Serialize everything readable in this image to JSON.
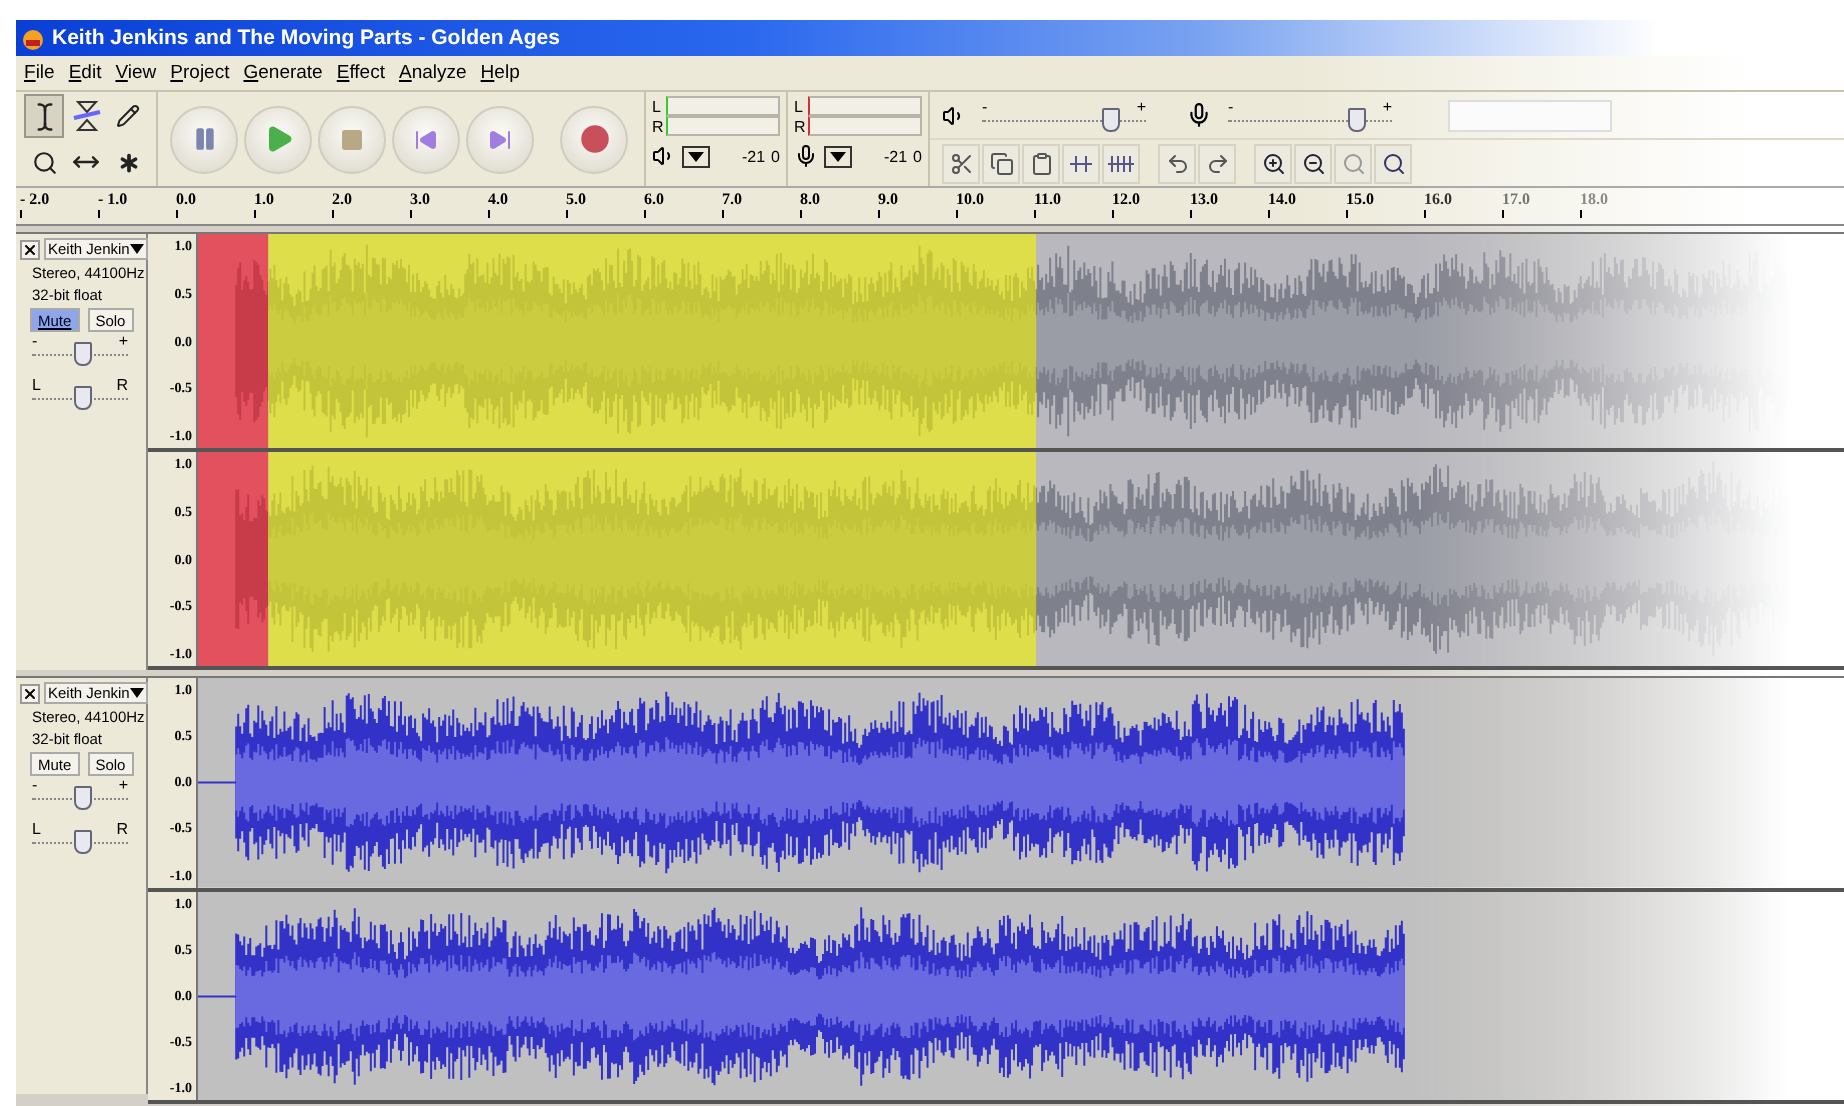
{
  "window": {
    "title": "Keith Jenkins and The Moving Parts - Golden Ages"
  },
  "menu": [
    "File",
    "Edit",
    "View",
    "Project",
    "Generate",
    "Effect",
    "Analyze",
    "Help"
  ],
  "tools": [
    {
      "kind": "select",
      "selected": true
    },
    {
      "kind": "envelope",
      "selected": false
    },
    {
      "kind": "draw",
      "selected": false
    },
    {
      "kind": "zoom",
      "selected": false
    },
    {
      "kind": "timeshift",
      "selected": false
    },
    {
      "kind": "multi",
      "selected": false
    }
  ],
  "transport": [
    {
      "kind": "pause"
    },
    {
      "kind": "play"
    },
    {
      "kind": "stop"
    },
    {
      "kind": "skip-start"
    },
    {
      "kind": "skip-end"
    },
    {
      "kind": "record"
    }
  ],
  "meters": [
    {
      "kind": "playback",
      "channels": [
        "L",
        "R"
      ],
      "scale": [
        "-21",
        "0"
      ]
    },
    {
      "kind": "record",
      "channels": [
        "L",
        "R"
      ],
      "scale": [
        "-21",
        "0"
      ]
    }
  ],
  "mixer": [
    {
      "kind": "output",
      "minus": "-",
      "plus": "+",
      "level": 0.8
    },
    {
      "kind": "input",
      "minus": "-",
      "plus": "+",
      "level": 0.8
    }
  ],
  "edit_tools": [
    {
      "kind": "cut"
    },
    {
      "kind": "copy"
    },
    {
      "kind": "paste"
    },
    {
      "kind": "trim"
    },
    {
      "kind": "silence"
    },
    {
      "kind": "undo"
    },
    {
      "kind": "redo"
    },
    {
      "kind": "zoom-in"
    },
    {
      "kind": "zoom-out"
    },
    {
      "kind": "fit-selection"
    },
    {
      "kind": "fit-project"
    }
  ],
  "ruler": [
    "- 2.0",
    "- 1.0",
    "0.0",
    "1.0",
    "2.0",
    "3.0",
    "4.0",
    "5.0",
    "6.0",
    "7.0",
    "8.0",
    "9.0",
    "10.0",
    "11.0",
    "12.0",
    "13.0",
    "14.0",
    "15.0",
    "16.0",
    "17.0",
    "18.0"
  ],
  "tracks": [
    {
      "name": "Keith Jenkin",
      "format": "Stereo, 44100Hz",
      "depth": "32-bit float",
      "mute": {
        "label": "Mute",
        "on": true
      },
      "solo": {
        "label": "Solo",
        "on": false
      },
      "gain": {
        "minus": "-",
        "plus": "+",
        "level": 0.5
      },
      "pan": {
        "left": "L",
        "right": "R",
        "level": 0.5
      },
      "selected": true,
      "channels": [
        {
          "axis": [
            "1.0",
            "0.5",
            "0.0",
            "-0.5",
            "-1.0"
          ]
        },
        {
          "axis": [
            "1.0",
            "0.5",
            "0.0",
            "-0.5",
            "-1.0"
          ]
        }
      ]
    },
    {
      "name": "Keith Jenkin",
      "format": "Stereo, 44100Hz",
      "depth": "32-bit float",
      "mute": {
        "label": "Mute",
        "on": false
      },
      "solo": {
        "label": "Solo",
        "on": false
      },
      "gain": {
        "minus": "-",
        "plus": "+",
        "level": 0.5
      },
      "pan": {
        "left": "L",
        "right": "R",
        "level": 0.5
      },
      "selected": false,
      "channels": [
        {
          "axis": [
            "1.0",
            "0.5",
            "0.0",
            "-0.5",
            "-1.0"
          ]
        },
        {
          "axis": [
            "1.0",
            "0.5",
            "0.0",
            "-0.5",
            "-1.0"
          ]
        }
      ]
    }
  ]
}
